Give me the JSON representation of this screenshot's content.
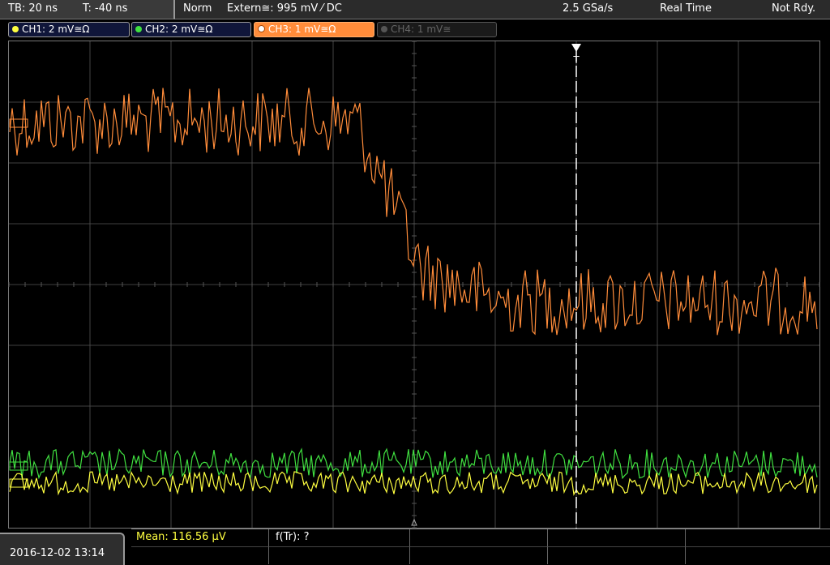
{
  "header": {
    "timebase": "TB: 20 ns",
    "trigger_time": "T: -40 ns",
    "trigger_mode": "Norm",
    "trigger_source": "Extern≅: 995 mV ⁄ DC",
    "sample_rate": "2.5 GSa/s",
    "acq_mode": "Real Time",
    "status": "Not Rdy."
  },
  "channels": [
    {
      "label": "CH1: 2 mV≅Ω",
      "color": "#ffff40",
      "state": "on"
    },
    {
      "label": "CH2: 2 mV≅Ω",
      "color": "#40e040",
      "state": "on"
    },
    {
      "label": "CH3: 1 mV≅Ω",
      "color": "#ff8c3a",
      "state": "active"
    },
    {
      "label": "CH4: 1 mV≅",
      "color": "#666666",
      "state": "off"
    }
  ],
  "trigger_marker": "T",
  "footer": {
    "datetime": "2016-12-02 13:14",
    "mean_label": "Mean: 116.56 µV",
    "ftr_label": "f(Tr): ?"
  },
  "colors": {
    "ch1": "#ffff40",
    "ch2": "#40e040",
    "ch3": "#ff8c3a",
    "grid": "#555555"
  }
}
